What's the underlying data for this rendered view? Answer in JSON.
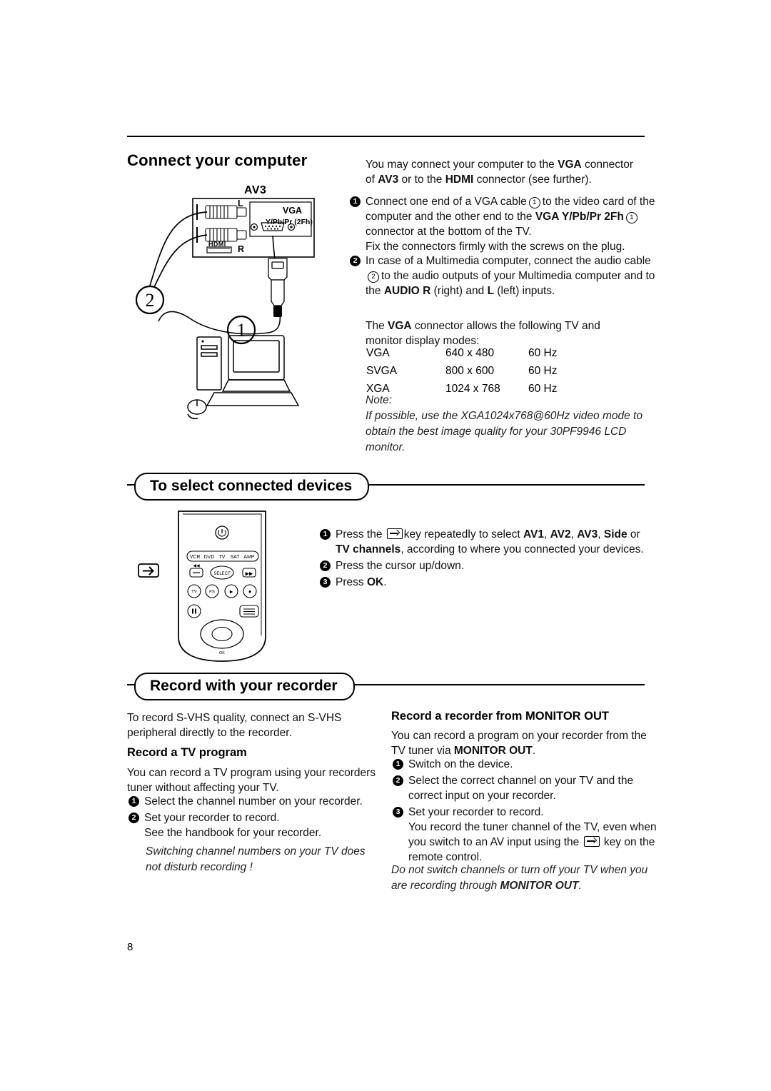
{
  "page": {
    "number": "8"
  },
  "section1": {
    "heading": "Connect your computer",
    "intro_1": "You may connect your computer to the ",
    "intro_vga": "VGA",
    "intro_2": " connector of ",
    "intro_av3": "AV3",
    "intro_3": " or to the ",
    "intro_hdmi": "HDMI",
    "intro_4": " connector (see further).",
    "step1": {
      "t1": "Connect one end of a VGA cable",
      "n1": "1",
      "t2": "to the video card of the computer and the other end to the ",
      "b1": "VGA Y/Pb/Pr 2Fh",
      "n2": "1",
      "t3": "connector at the bottom of the TV.",
      "t4": "Fix the connectors firmly with the screws on the plug."
    },
    "step2": {
      "t1": "In case of a Multimedia computer, connect the audio cable",
      "n1": "2",
      "t2": "to the audio outputs of your Multimedia computer and to the ",
      "b1": "AUDIO R",
      "t3": " (right) and ",
      "b2": "L",
      "t4": " (left) inputs."
    },
    "modes_intro_1": "The ",
    "modes_intro_vga": "VGA",
    "modes_intro_2": " connector allows the following TV and monitor display modes:",
    "modes": [
      {
        "name": "VGA",
        "res": "640 x 480",
        "rate": "60 Hz"
      },
      {
        "name": "SVGA",
        "res": "800 x 600",
        "rate": "60 Hz"
      },
      {
        "name": "XGA",
        "res": "1024 x 768",
        "rate": "60 Hz"
      }
    ],
    "note_label": "Note:",
    "note_text": "If possible, use the XGA1024x768@60Hz video mode to obtain the best image quality for your 30PF9946 LCD monitor.",
    "diagram": {
      "av3_label": "AV3",
      "l_label": "L",
      "r_label": "R",
      "vga_label": "VGA",
      "vga_sub": "Y/Pb/Pr (2Fh)",
      "hdmi_label": "HDMI",
      "big_two": "2",
      "big_one": "1"
    }
  },
  "section2": {
    "heading": "To select connected devices",
    "step1_1": "Press the",
    "step1_key": "av-key",
    "step1_2": "key repeatedly to select ",
    "step1_b1": "AV1",
    "step1_c1": ", ",
    "step1_b2": "AV2",
    "step1_c2": ", ",
    "step1_b3": "AV3",
    "step1_c3": ", ",
    "step1_b4": "Side",
    "step1_3": " or ",
    "step1_b5": "TV channels",
    "step1_4": ", according to where you connected your devices.",
    "step2": "Press the cursor up/down.",
    "step3_1": "Press ",
    "step3_b": "OK",
    "step3_2": ".",
    "remote": {
      "power": "⏻",
      "keys": [
        "VCR",
        "DVD",
        "TV",
        "SAT",
        "AMP"
      ],
      "select": "SELECT"
    }
  },
  "section3": {
    "heading": "Record with your recorder",
    "left": {
      "intro": "To record S-VHS quality, connect an S-VHS peripheral directly to the recorder.",
      "sub": "Record a TV program",
      "p1": "You can record a TV program using your recorders tuner without affecting your TV.",
      "s1": "Select the channel number on your recorder.",
      "s2a": "Set your recorder to record.",
      "s2b": "See the handbook for your recorder.",
      "note": "Switching channel numbers on your TV does not disturb recording !"
    },
    "right": {
      "sub_1": "Record a recorder from ",
      "sub_b": "MONITOR OUT",
      "p1_1": "You can record a program on your recorder from the TV tuner via ",
      "p1_b": "MONITOR OUT",
      "p1_2": ".",
      "s1": "Switch on the device.",
      "s2": "Select the correct channel on your TV and the correct input on your recorder.",
      "s3a": "Set your recorder to record.",
      "s3b_1": "You record the tuner channel of the TV, even when you switch to an AV input using the",
      "s3b_2": "key on the remote control.",
      "note_1": "Do not switch channels or turn off your TV when you are recording through ",
      "note_b": "MONITOR OUT",
      "note_2": "."
    }
  }
}
